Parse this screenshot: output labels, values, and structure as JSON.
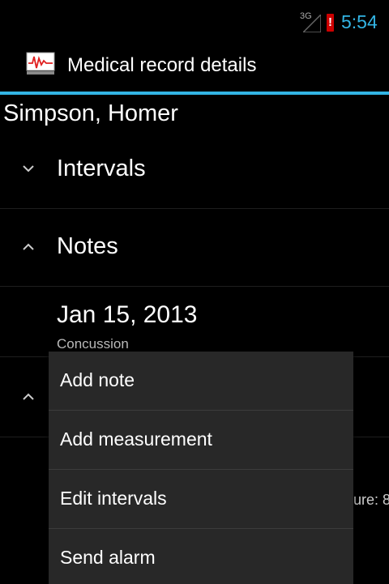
{
  "status_bar": {
    "network_label": "3G",
    "time": "5:54",
    "battery_alert": "!",
    "time_color": "#33b5e5",
    "battery_color": "#cc0000"
  },
  "action_bar": {
    "title": "Medical record details",
    "icon": "medical-chart-icon",
    "accent_color": "#33b5e5"
  },
  "record": {
    "patient_name": "Simpson, Homer",
    "groups": [
      {
        "label": "Intervals",
        "state": "collapsed",
        "icon": "chevron-down-icon"
      },
      {
        "label": "Notes",
        "state": "expanded",
        "icon": "chevron-up-icon"
      }
    ],
    "note": {
      "date": "Jan 15, 2013",
      "description": "Concussion"
    },
    "partial_text": "ure: 8"
  },
  "popup_menu": {
    "items": [
      {
        "label": "Add note"
      },
      {
        "label": "Add measurement"
      },
      {
        "label": "Edit intervals"
      },
      {
        "label": "Send alarm"
      }
    ]
  }
}
